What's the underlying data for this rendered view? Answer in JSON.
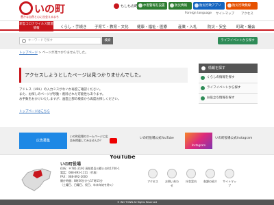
{
  "header": {
    "logo": "いの町",
    "tagline": "豊かな自然と心に出会えるまち",
    "moshimo": "もしもの時に",
    "emergency": [
      "水害警報を設置",
      "防災情報",
      "防災行政アプリ",
      "防災行政無線"
    ],
    "toolbar": {
      "language": "Foreign language",
      "sitemap": "サイトマップ",
      "access": "アクセス"
    }
  },
  "nav": {
    "corona": "新型コロナウイルス関連情報",
    "items": [
      "くらし・手続き",
      "子育て・教育・文化",
      "健康・福祉・医療",
      "産業・入札",
      "防災・安全",
      "町政・議会"
    ]
  },
  "search": {
    "placeholder": "キーワードで探す",
    "button": "検索",
    "life_button": "ライフイベントから探す"
  },
  "breadcrumb": {
    "top": "トップページ",
    "current": "ページが見つかりませんでした。"
  },
  "error": {
    "title": "アクセスしようとしたページは見つかりませんでした。",
    "lines": [
      "アドレス（URL）の入力ミスがないか再度ご確認ください。",
      "また、お探しのページが移動・削除された可能性もあります。",
      "お手数をおかけいたしますが、画面上部の検索から再度お探しください。"
    ],
    "top_link": "トップページはこちら"
  },
  "sidebar": {
    "title": "情報を探す",
    "items": [
      "くらしの情報を探す",
      "ライフイベントから探す",
      "お役立ち情報を探す"
    ]
  },
  "banners": {
    "ad": "広告募集",
    "ad_text": "いの町役場のホームページに広告を掲載してみませんか？",
    "youtube": "YouTube",
    "youtube_text": "いの町役場公式YouTube",
    "instagram": "Instagram",
    "instagram_text": "いの町役場公式Instagram"
  },
  "footer": {
    "office": "いの町役場",
    "address": "住所：〒781-2192 高知県吾川郡いの町1700-1",
    "tel": "電話：088-893-1111（代表）",
    "fax": "FAX：088-892-2000",
    "hours": "開庁時間：8時30分から17時15分",
    "closed": "（土曜日、日曜日、祝日、年末年始を除く）",
    "icons": [
      "アクセス",
      "お問い合わせ",
      "庁舎案内",
      "各課の紹介",
      "サイトマップ"
    ]
  },
  "copyright": "© INO TOWN All Rights Reserved"
}
